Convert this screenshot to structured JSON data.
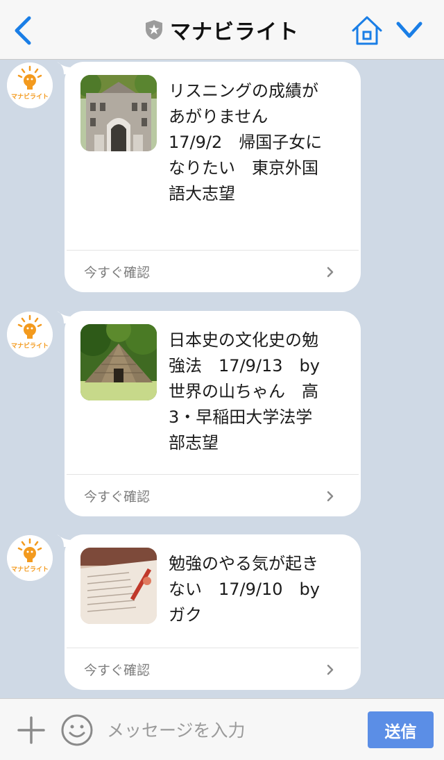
{
  "header": {
    "title": "マナビライト",
    "accent_color": "#1a7ee6"
  },
  "messages": [
    {
      "avatar_text": "マナビライト",
      "text": "リスニングの成績があがりません　17/9/2　帰国子女になりたい　東京外国語大志望",
      "lines": [
        "リスニングの成績が",
        "あがりません",
        "17/9/2　帰国子女に",
        "なりたい　東京外国",
        "語大志望"
      ],
      "action_label": "今すぐ確認",
      "thumbnail": "university-building"
    },
    {
      "avatar_text": "マナビライト",
      "text": "日本史の文化史の勉強法　17/9/13　by　世界の山ちゃん　高3・早稲田大学法学部志望",
      "lines": [
        "日本史の文化史の勉",
        "強法　17/9/13　by",
        "世界の山ちゃん　高",
        "3・早稲田大学法学",
        "部志望"
      ],
      "action_label": "今すぐ確認",
      "thumbnail": "thatched-pit-dwelling"
    },
    {
      "avatar_text": "マナビライト",
      "text": "勉強のやる気が起きない　17/9/10　by　ガク",
      "lines": [
        "勉強のやる気が起き",
        "ない　17/9/10　by",
        "ガク"
      ],
      "action_label": "今すぐ確認",
      "thumbnail": "open-book-study"
    }
  ],
  "input": {
    "placeholder": "メッセージを入力",
    "send_label": "送信"
  },
  "icons": {
    "back": "chevron-left-icon",
    "badge": "shield-star-icon",
    "home": "home-icon",
    "menu": "chevron-down-icon",
    "plus": "plus-icon",
    "emoji": "smiley-icon"
  },
  "colors": {
    "background": "#cfd9e5",
    "bubble": "#ffffff",
    "brand_orange": "#f39a1e",
    "send_button": "#5b8ee6"
  }
}
